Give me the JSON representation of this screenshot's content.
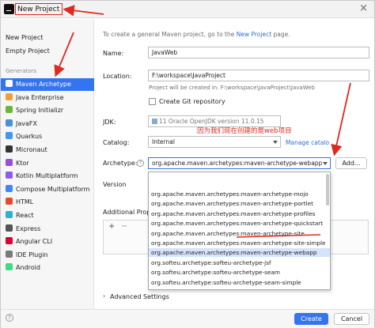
{
  "title": "New Project",
  "sidebar": {
    "top_items": [
      "New Project",
      "Empty Project"
    ],
    "section_label": "Generators",
    "generators": [
      {
        "label": "Maven Archetype",
        "selected": true,
        "icon": "maven-icon",
        "color": "#3b78d1"
      },
      {
        "label": "Java Enterprise",
        "icon": "java-enterprise-icon",
        "color": "#f0a030"
      },
      {
        "label": "Spring Initializr",
        "icon": "spring-icon",
        "color": "#6db33f"
      },
      {
        "label": "JavaFX",
        "icon": "javafx-icon",
        "color": "#4a90d9"
      },
      {
        "label": "Quarkus",
        "icon": "quarkus-icon",
        "color": "#4695eb"
      },
      {
        "label": "Micronaut",
        "icon": "micronaut-icon",
        "color": "#333333"
      },
      {
        "label": "Ktor",
        "icon": "ktor-icon",
        "color": "#9b4de0"
      },
      {
        "label": "Kotlin Multiplatform",
        "icon": "kotlin-icon",
        "color": "#8e5ce8"
      },
      {
        "label": "Compose Multiplatform",
        "icon": "compose-icon",
        "color": "#4285f4"
      },
      {
        "label": "HTML",
        "icon": "html-icon",
        "color": "#e44d26"
      },
      {
        "label": "React",
        "icon": "react-icon",
        "color": "#2bb3d4"
      },
      {
        "label": "Express",
        "icon": "express-icon",
        "color": "#555555"
      },
      {
        "label": "Angular CLI",
        "icon": "angular-icon",
        "color": "#dd0031"
      },
      {
        "label": "IDE Plugin",
        "icon": "plugin-icon",
        "color": "#7a7a7a"
      },
      {
        "label": "Android",
        "icon": "android-icon",
        "color": "#3ddc84"
      }
    ]
  },
  "main": {
    "intro_prefix": "To create a general Maven project, go to the ",
    "intro_link": "New Project",
    "intro_suffix": " page.",
    "name_label": "Name:",
    "name_value": "JavaWeb",
    "location_label": "Location:",
    "location_value": "F:\\workspace\\JavaProject",
    "location_hint": "Project will be created in: F:\\workspace\\JavaProject\\JavaWeb",
    "git_label": "Create Git repository",
    "jdk_label": "JDK:",
    "jdk_value": "11 Oracle OpenJDK version 11.0.15",
    "catalog_label": "Catalog:",
    "catalog_value": "Internal",
    "manage_catalogs": "Manage catalo",
    "archetype_label": "Archetype:",
    "archetype_value": "org.apache.maven.archetypes:maven-archetype-webapp",
    "add_button": "Add...",
    "version_label": "Version",
    "additional_label": "Additional Prope",
    "plus": "+",
    "minus": "−",
    "advanced_label": "Advanced Settings",
    "create_button": "Create",
    "cancel_button": "Cancel"
  },
  "dropdown_options": [
    {
      "label": "org.apache.maven.archetypes:maven-archetype-mojo",
      "highlighted": false
    },
    {
      "label": "org.apache.maven.archetypes:maven-archetype-portlet",
      "highlighted": false
    },
    {
      "label": "org.apache.maven.archetypes:maven-archetype-profiles",
      "highlighted": false
    },
    {
      "label": "org.apache.maven.archetypes:maven-archetype-quickstart",
      "highlighted": false
    },
    {
      "label": "org.apache.maven.archetypes:maven-archetype-site",
      "highlighted": false
    },
    {
      "label": "org.apache.maven.archetypes:maven-archetype-site-simple",
      "highlighted": false
    },
    {
      "label": "org.apache.maven.archetypes:maven-archetype-webapp",
      "highlighted": true
    },
    {
      "label": "org.softeu.archetype:softeu-archetype-jsf",
      "highlighted": false
    },
    {
      "label": "org.softeu.archetype:softeu-archetype-seam",
      "highlighted": false
    },
    {
      "label": "org.softeu.archetype:softeu-archetype-seam-simple",
      "highlighted": false
    }
  ],
  "annotation_text": "因为我们现在创建的是web项目",
  "colors": {
    "accent": "#3574f0",
    "annotation": "#e0291f",
    "link": "#2f6ddb"
  }
}
